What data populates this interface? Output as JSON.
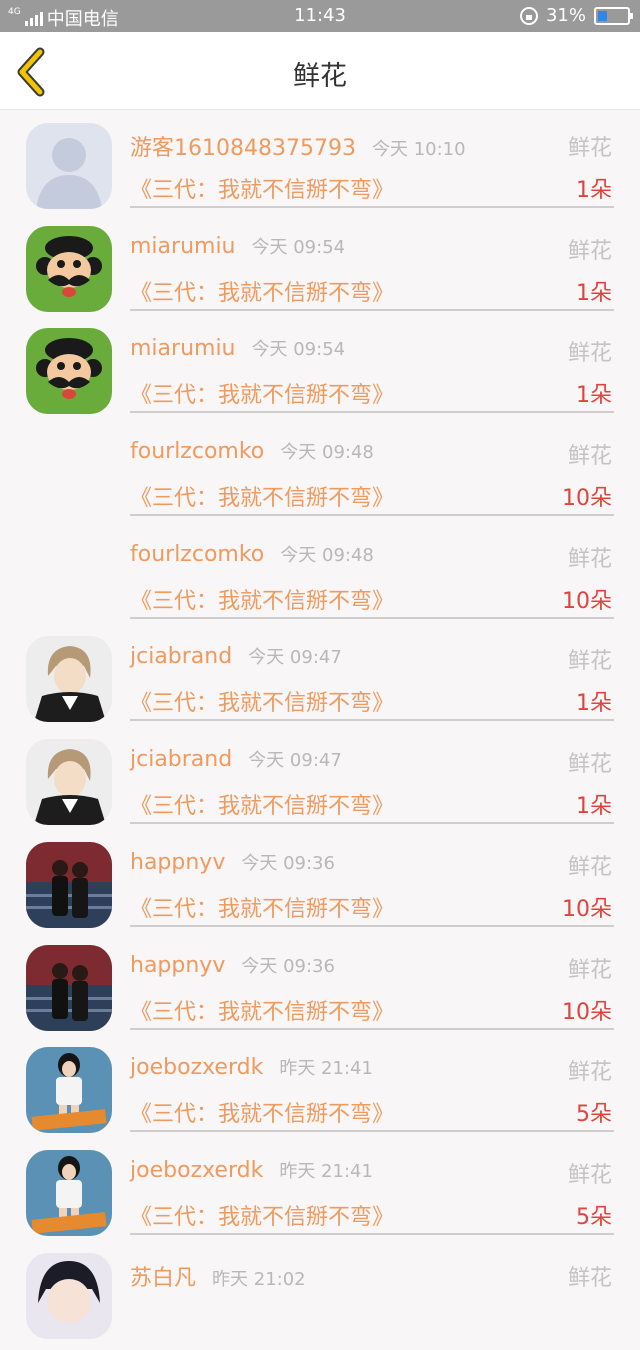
{
  "status_bar": {
    "network": "4G",
    "carrier": "中国电信",
    "time": "11:43",
    "battery": "31%",
    "battery_level": 0.31
  },
  "header": {
    "title": "鲜花",
    "back_icon": "chevron-left-icon",
    "accent_color": "#f2c400"
  },
  "colors": {
    "name": "#f09a5e",
    "count": "#e0433c",
    "muted": "#b8b8b8"
  },
  "records": [
    {
      "name": "游客1610848375793",
      "time": "今天 10:10",
      "label": "鲜花",
      "book": "《三代：我就不信掰不弯》",
      "count": "1朵",
      "avatar": "default-avatar"
    },
    {
      "name": "miarumiu",
      "time": "今天 09:54",
      "label": "鲜花",
      "book": "《三代：我就不信掰不弯》",
      "count": "1朵",
      "avatar": "monkey-avatar"
    },
    {
      "name": "miarumiu",
      "time": "今天 09:54",
      "label": "鲜花",
      "book": "《三代：我就不信掰不弯》",
      "count": "1朵",
      "avatar": "monkey-avatar"
    },
    {
      "name": "fourlzcomko",
      "time": "今天 09:48",
      "label": "鲜花",
      "book": "《三代：我就不信掰不弯》",
      "count": "10朵",
      "avatar": "none"
    },
    {
      "name": "fourlzcomko",
      "time": "今天 09:48",
      "label": "鲜花",
      "book": "《三代：我就不信掰不弯》",
      "count": "10朵",
      "avatar": "none"
    },
    {
      "name": "jciabrand",
      "time": "今天 09:47",
      "label": "鲜花",
      "book": "《三代：我就不信掰不弯》",
      "count": "1朵",
      "avatar": "anime-avatar"
    },
    {
      "name": "jciabrand",
      "time": "今天 09:47",
      "label": "鲜花",
      "book": "《三代：我就不信掰不弯》",
      "count": "1朵",
      "avatar": "anime-avatar"
    },
    {
      "name": "happnyv",
      "time": "今天 09:36",
      "label": "鲜花",
      "book": "《三代：我就不信掰不弯》",
      "count": "10朵",
      "avatar": "couple-avatar"
    },
    {
      "name": "happnyv",
      "time": "今天 09:36",
      "label": "鲜花",
      "book": "《三代：我就不信掰不弯》",
      "count": "10朵",
      "avatar": "couple-avatar"
    },
    {
      "name": "joebozxerdk",
      "time": "昨天 21:41",
      "label": "鲜花",
      "book": "《三代：我就不信掰不弯》",
      "count": "5朵",
      "avatar": "girl-avatar"
    },
    {
      "name": "joebozxerdk",
      "time": "昨天 21:41",
      "label": "鲜花",
      "book": "《三代：我就不信掰不弯》",
      "count": "5朵",
      "avatar": "girl-avatar"
    },
    {
      "name": "苏白凡",
      "time": "昨天 21:02",
      "label": "鲜花",
      "book": "",
      "count": "",
      "avatar": "cartoon-avatar"
    }
  ]
}
